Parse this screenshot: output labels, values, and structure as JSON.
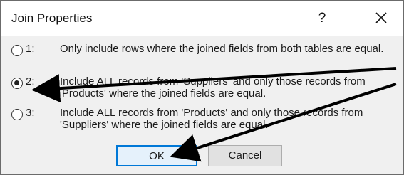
{
  "dialog": {
    "title": "Join Properties",
    "help_label": "?",
    "options": [
      {
        "number": "1:",
        "selected": false,
        "text": "Only include rows where the joined fields from both tables are equal."
      },
      {
        "number": "2:",
        "selected": true,
        "text": "Include ALL records from 'Suppliers' and only those records from 'Products' where the joined fields are equal."
      },
      {
        "number": "3:",
        "selected": false,
        "text": "Include ALL records from 'Products' and only those records from 'Suppliers' where the joined fields are equal."
      }
    ],
    "ok_label": "OK",
    "cancel_label": "Cancel"
  },
  "icons": {
    "close": "close-icon",
    "annotation": "arrow-icon"
  },
  "colors": {
    "title_background": "#ffffff",
    "dialog_background": "#f0f0f0",
    "ok_border": "#0078d7",
    "arrow": "#000000"
  }
}
